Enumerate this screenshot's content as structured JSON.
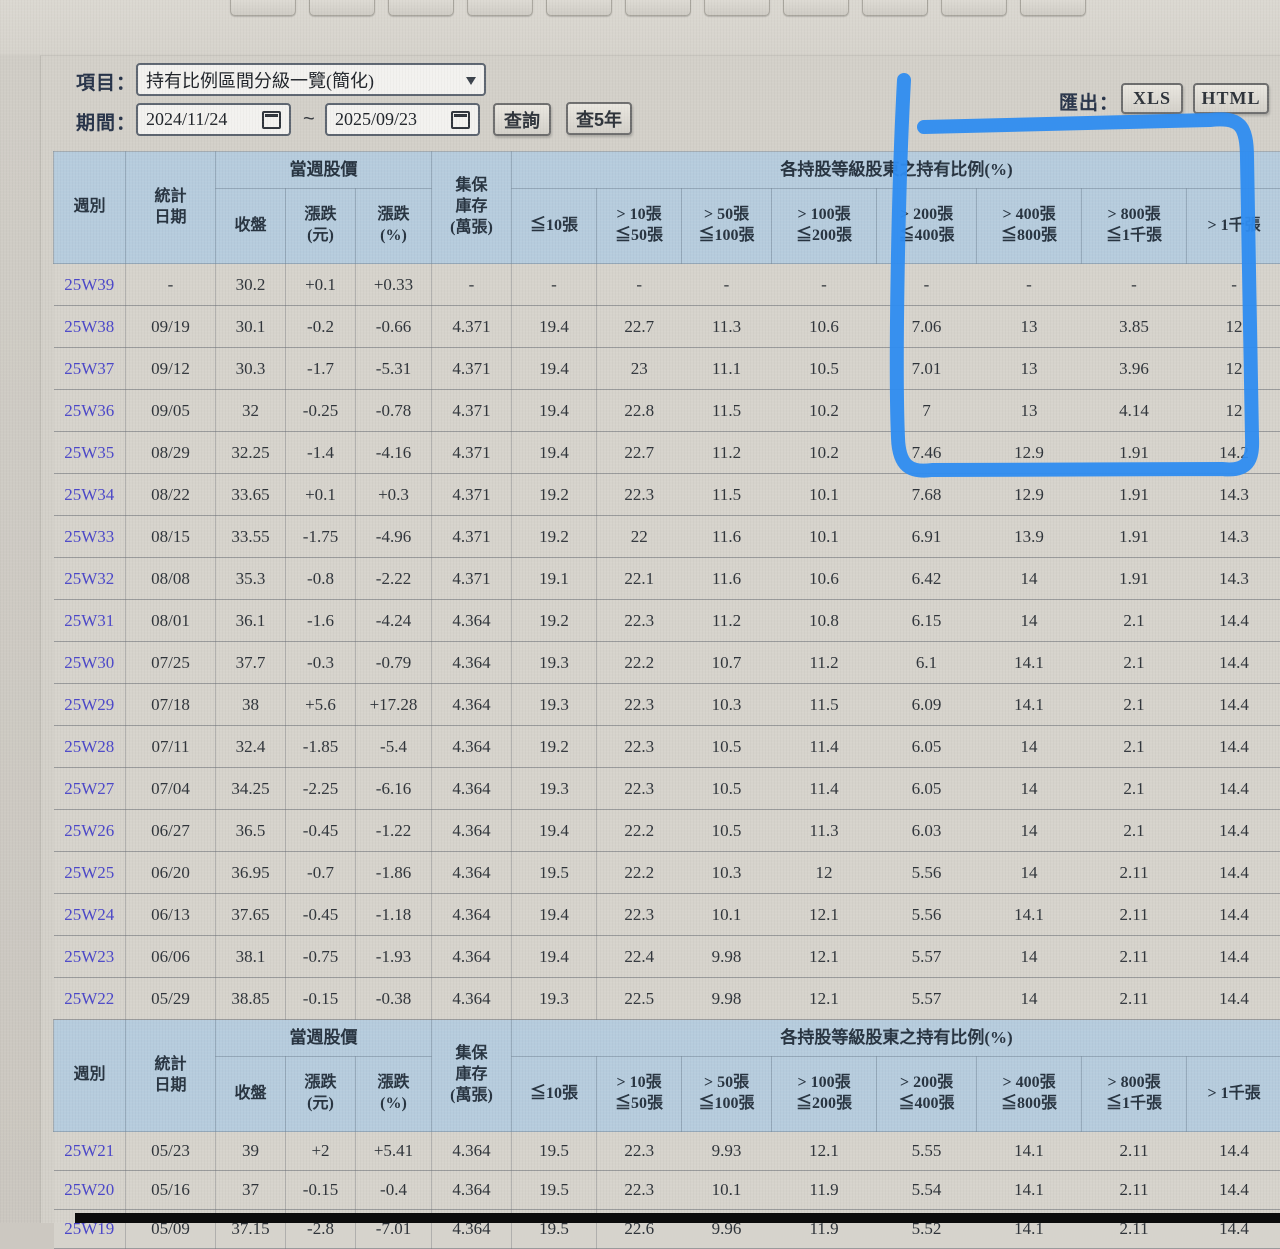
{
  "controls": {
    "item_label": "項目：",
    "item_value": "持有比例區間分級一覽(簡化)",
    "period_label": "期間：",
    "date_from": "2024/11/24",
    "date_to": "2025/09/23",
    "tilde": "~",
    "query_button": "查詢",
    "query_5y_button": "查5年",
    "export_label": "匯出：",
    "export_xls": "XLS",
    "export_html": "HTML"
  },
  "annotation": {
    "shape": "hand-drawn-rectangle",
    "marker_color": "#2e8cf0"
  },
  "table": {
    "header": {
      "week": "週別",
      "stat_date": "統計\n日期",
      "price_group": "當週股價",
      "close": "收盤",
      "chg": "漲跌\n(元)",
      "pct": "漲跌\n(%)",
      "inv": "集保\n庫存\n(萬張)",
      "ratio_group": "各持股等級股東之持有比例(%)",
      "b1": "≦10張",
      "b2": "> 10張\n≦50張",
      "b3": "> 50張\n≦100張",
      "b4": "> 100張\n≦200張",
      "b5": "> 200張\n≦400張",
      "b6": "> 400張\n≦800張",
      "b7": "> 800張\n≦1千張",
      "b8": "> 1千張"
    },
    "rows_top": [
      {
        "week": "25W39",
        "date": "-",
        "close": "30.2",
        "chg": "+0.1",
        "pct": "+0.33",
        "dir": "up",
        "inv": "-",
        "b1": "-",
        "b2": "-",
        "b3": "-",
        "b4": "-",
        "b5": "-",
        "b6": "-",
        "b7": "-",
        "b8": "-"
      },
      {
        "week": "25W38",
        "date": "09/19",
        "close": "30.1",
        "chg": "-0.2",
        "pct": "-0.66",
        "dir": "down",
        "inv": "4.371",
        "b1": "19.4",
        "b2": "22.7",
        "b3": "11.3",
        "b4": "10.6",
        "b5": "7.06",
        "b6": "13",
        "b7": "3.85",
        "b8": "12"
      },
      {
        "week": "25W37",
        "date": "09/12",
        "close": "30.3",
        "chg": "-1.7",
        "pct": "-5.31",
        "dir": "down",
        "inv": "4.371",
        "b1": "19.4",
        "b2": "23",
        "b3": "11.1",
        "b4": "10.5",
        "b5": "7.01",
        "b6": "13",
        "b7": "3.96",
        "b8": "12"
      },
      {
        "week": "25W36",
        "date": "09/05",
        "close": "32",
        "chg": "-0.25",
        "pct": "-0.78",
        "dir": "down",
        "inv": "4.371",
        "b1": "19.4",
        "b2": "22.8",
        "b3": "11.5",
        "b4": "10.2",
        "b5": "7",
        "b6": "13",
        "b7": "4.14",
        "b8": "12"
      },
      {
        "week": "25W35",
        "date": "08/29",
        "close": "32.25",
        "chg": "-1.4",
        "pct": "-4.16",
        "dir": "down",
        "inv": "4.371",
        "b1": "19.4",
        "b2": "22.7",
        "b3": "11.2",
        "b4": "10.2",
        "b5": "7.46",
        "b6": "12.9",
        "b7": "1.91",
        "b8": "14.2"
      },
      {
        "week": "25W34",
        "date": "08/22",
        "close": "33.65",
        "chg": "+0.1",
        "pct": "+0.3",
        "dir": "up",
        "inv": "4.371",
        "b1": "19.2",
        "b2": "22.3",
        "b3": "11.5",
        "b4": "10.1",
        "b5": "7.68",
        "b6": "12.9",
        "b7": "1.91",
        "b8": "14.3"
      },
      {
        "week": "25W33",
        "date": "08/15",
        "close": "33.55",
        "chg": "-1.75",
        "pct": "-4.96",
        "dir": "down",
        "inv": "4.371",
        "b1": "19.2",
        "b2": "22",
        "b3": "11.6",
        "b4": "10.1",
        "b5": "6.91",
        "b6": "13.9",
        "b7": "1.91",
        "b8": "14.3"
      },
      {
        "week": "25W32",
        "date": "08/08",
        "close": "35.3",
        "chg": "-0.8",
        "pct": "-2.22",
        "dir": "down",
        "inv": "4.371",
        "b1": "19.1",
        "b2": "22.1",
        "b3": "11.6",
        "b4": "10.6",
        "b5": "6.42",
        "b6": "14",
        "b7": "1.91",
        "b8": "14.3"
      },
      {
        "week": "25W31",
        "date": "08/01",
        "close": "36.1",
        "chg": "-1.6",
        "pct": "-4.24",
        "dir": "down",
        "inv": "4.364",
        "b1": "19.2",
        "b2": "22.3",
        "b3": "11.2",
        "b4": "10.8",
        "b5": "6.15",
        "b6": "14",
        "b7": "2.1",
        "b8": "14.4"
      },
      {
        "week": "25W30",
        "date": "07/25",
        "close": "37.7",
        "chg": "-0.3",
        "pct": "-0.79",
        "dir": "down",
        "inv": "4.364",
        "b1": "19.3",
        "b2": "22.2",
        "b3": "10.7",
        "b4": "11.2",
        "b5": "6.1",
        "b6": "14.1",
        "b7": "2.1",
        "b8": "14.4"
      },
      {
        "week": "25W29",
        "date": "07/18",
        "close": "38",
        "chg": "+5.6",
        "pct": "+17.28",
        "dir": "up",
        "inv": "4.364",
        "b1": "19.3",
        "b2": "22.3",
        "b3": "10.3",
        "b4": "11.5",
        "b5": "6.09",
        "b6": "14.1",
        "b7": "2.1",
        "b8": "14.4"
      },
      {
        "week": "25W28",
        "date": "07/11",
        "close": "32.4",
        "chg": "-1.85",
        "pct": "-5.4",
        "dir": "down",
        "inv": "4.364",
        "b1": "19.2",
        "b2": "22.3",
        "b3": "10.5",
        "b4": "11.4",
        "b5": "6.05",
        "b6": "14",
        "b7": "2.1",
        "b8": "14.4"
      },
      {
        "week": "25W27",
        "date": "07/04",
        "close": "34.25",
        "chg": "-2.25",
        "pct": "-6.16",
        "dir": "down",
        "inv": "4.364",
        "b1": "19.3",
        "b2": "22.3",
        "b3": "10.5",
        "b4": "11.4",
        "b5": "6.05",
        "b6": "14",
        "b7": "2.1",
        "b8": "14.4"
      },
      {
        "week": "25W26",
        "date": "06/27",
        "close": "36.5",
        "chg": "-0.45",
        "pct": "-1.22",
        "dir": "down",
        "inv": "4.364",
        "b1": "19.4",
        "b2": "22.2",
        "b3": "10.5",
        "b4": "11.3",
        "b5": "6.03",
        "b6": "14",
        "b7": "2.1",
        "b8": "14.4"
      },
      {
        "week": "25W25",
        "date": "06/20",
        "close": "36.95",
        "chg": "-0.7",
        "pct": "-1.86",
        "dir": "down",
        "inv": "4.364",
        "b1": "19.5",
        "b2": "22.2",
        "b3": "10.3",
        "b4": "12",
        "b5": "5.56",
        "b6": "14",
        "b7": "2.11",
        "b8": "14.4"
      },
      {
        "week": "25W24",
        "date": "06/13",
        "close": "37.65",
        "chg": "-0.45",
        "pct": "-1.18",
        "dir": "down",
        "inv": "4.364",
        "b1": "19.4",
        "b2": "22.3",
        "b3": "10.1",
        "b4": "12.1",
        "b5": "5.56",
        "b6": "14.1",
        "b7": "2.11",
        "b8": "14.4"
      },
      {
        "week": "25W23",
        "date": "06/06",
        "close": "38.1",
        "chg": "-0.75",
        "pct": "-1.93",
        "dir": "down",
        "inv": "4.364",
        "b1": "19.4",
        "b2": "22.4",
        "b3": "9.98",
        "b4": "12.1",
        "b5": "5.57",
        "b6": "14",
        "b7": "2.11",
        "b8": "14.4"
      },
      {
        "week": "25W22",
        "date": "05/29",
        "close": "38.85",
        "chg": "-0.15",
        "pct": "-0.38",
        "dir": "down",
        "inv": "4.364",
        "b1": "19.3",
        "b2": "22.5",
        "b3": "9.98",
        "b4": "12.1",
        "b5": "5.57",
        "b6": "14",
        "b7": "2.11",
        "b8": "14.4"
      }
    ],
    "rows_bottom": [
      {
        "week": "25W21",
        "date": "05/23",
        "close": "39",
        "chg": "+2",
        "pct": "+5.41",
        "dir": "up",
        "inv": "4.364",
        "b1": "19.5",
        "b2": "22.3",
        "b3": "9.93",
        "b4": "12.1",
        "b5": "5.55",
        "b6": "14.1",
        "b7": "2.11",
        "b8": "14.4"
      },
      {
        "week": "25W20",
        "date": "05/16",
        "close": "37",
        "chg": "-0.15",
        "pct": "-0.4",
        "dir": "down",
        "inv": "4.364",
        "b1": "19.5",
        "b2": "22.3",
        "b3": "10.1",
        "b4": "11.9",
        "b5": "5.54",
        "b6": "14.1",
        "b7": "2.11",
        "b8": "14.4"
      },
      {
        "week": "25W19",
        "date": "05/09",
        "close": "37.15",
        "chg": "-2.8",
        "pct": "-7.01",
        "dir": "down",
        "inv": "4.364",
        "b1": "19.5",
        "b2": "22.6",
        "b3": "9.96",
        "b4": "11.9",
        "b5": "5.52",
        "b6": "14.1",
        "b7": "2.11",
        "b8": "14.4"
      }
    ]
  }
}
